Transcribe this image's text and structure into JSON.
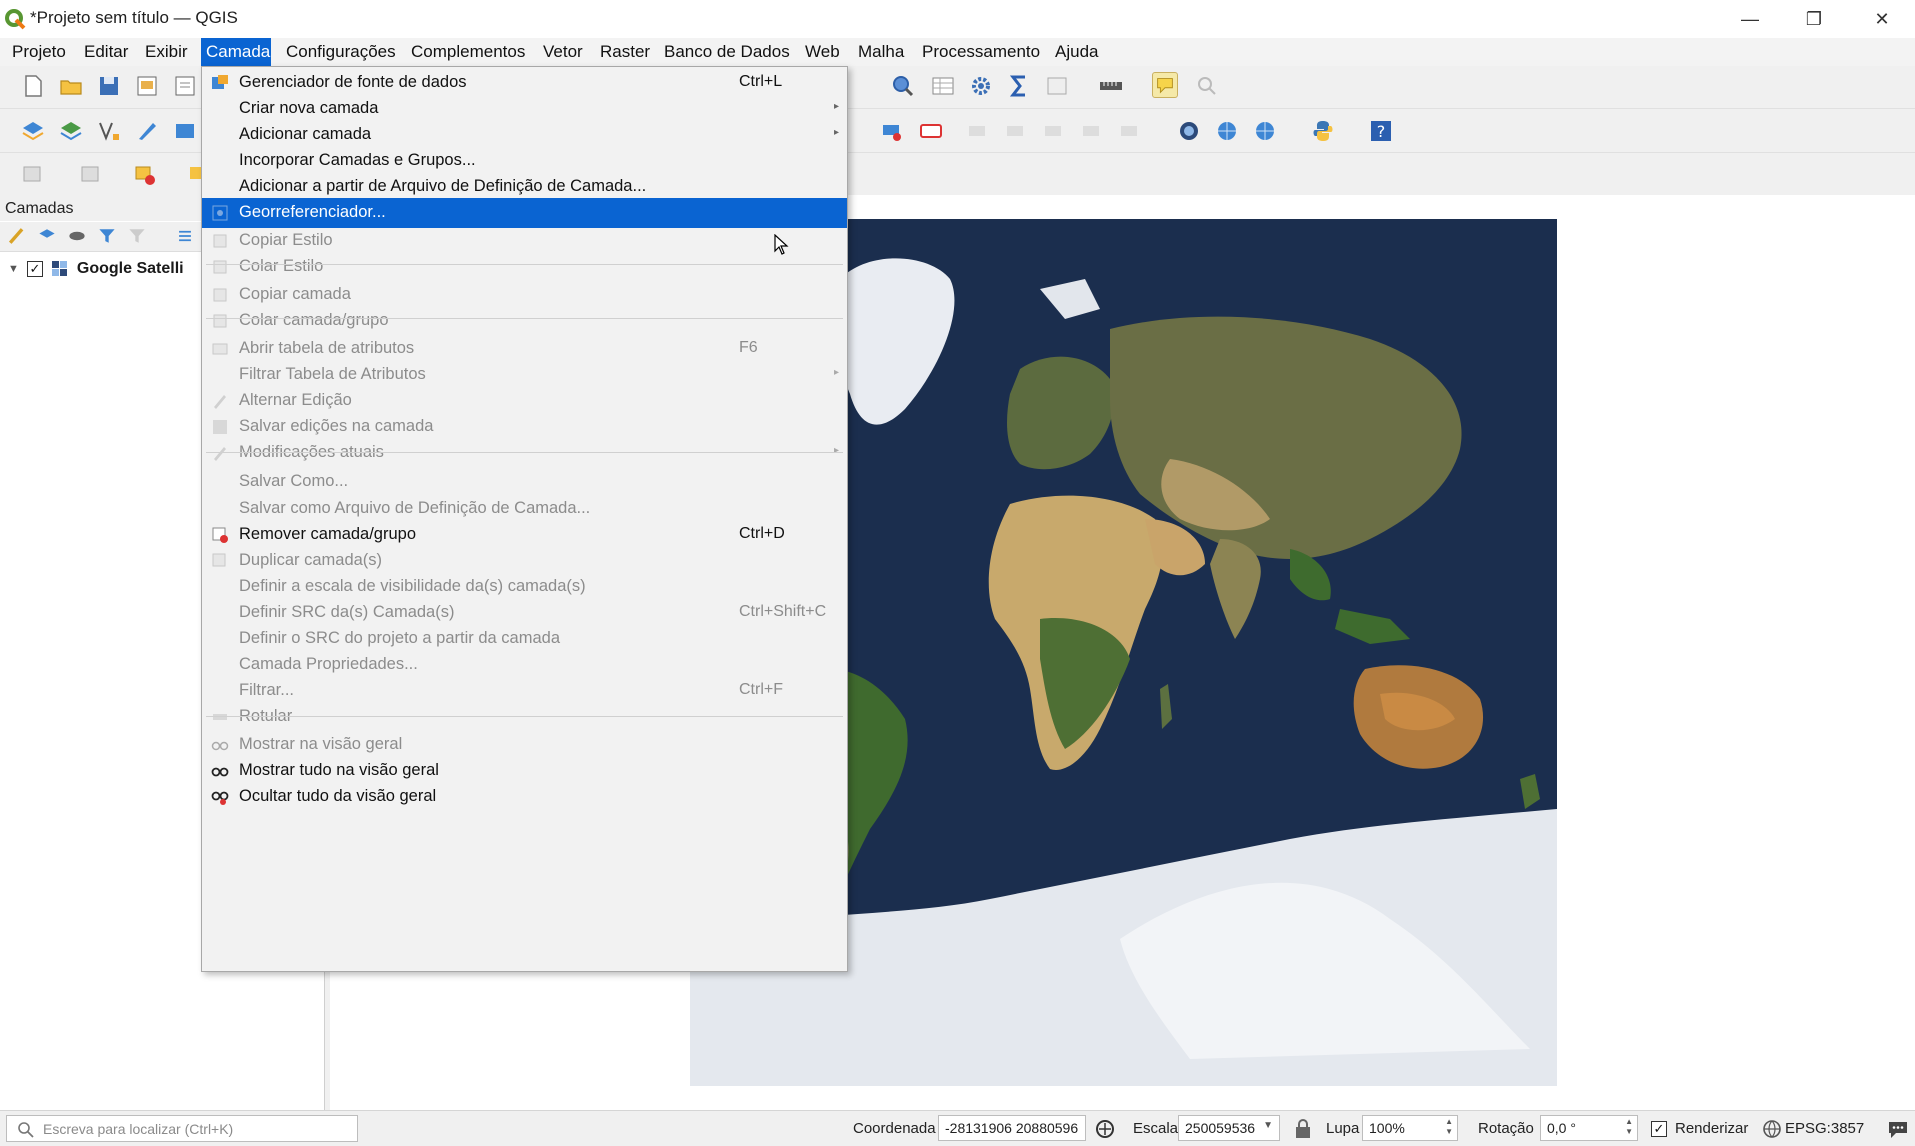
{
  "window": {
    "title": "*Projeto sem título — QGIS",
    "minimize": "—",
    "maximize": "❐",
    "close": "✕"
  },
  "menubar": [
    {
      "label": "Projeto"
    },
    {
      "label": "Editar"
    },
    {
      "label": "Exibir"
    },
    {
      "label": "Camada"
    },
    {
      "label": "Configurações"
    },
    {
      "label": "Complementos"
    },
    {
      "label": "Vetor"
    },
    {
      "label": "Raster"
    },
    {
      "label": "Banco de Dados"
    },
    {
      "label": "Web"
    },
    {
      "label": "Malha"
    },
    {
      "label": "Processamento"
    },
    {
      "label": "Ajuda"
    }
  ],
  "layers_panel": {
    "title": "Camadas",
    "layer": {
      "name": "Google Satelli",
      "checked": "✓",
      "expander": "▼"
    }
  },
  "dropdown": {
    "items": [
      {
        "label": "Gerenciador de fonte de dados",
        "shortcut": "Ctrl+L",
        "icon": "data-source-manager-icon"
      },
      {
        "label": "Criar nova camada",
        "arrow": "▸"
      },
      {
        "label": "Adicionar camada",
        "arrow": "▸"
      },
      {
        "label": "Incorporar Camadas e Grupos..."
      },
      {
        "label": "Adicionar a partir de Arquivo de Definição de Camada..."
      },
      {
        "label": "Georreferenciador...",
        "icon": "georeferencer-icon"
      },
      {
        "label": "Copiar Estilo",
        "icon": "copy-style-icon"
      },
      {
        "label": "Colar Estilo",
        "icon": "paste-style-icon"
      },
      {
        "label": "Copiar camada",
        "icon": "copy-layer-icon"
      },
      {
        "label": "Colar camada/grupo",
        "icon": "paste-layer-icon"
      },
      {
        "label": "Abrir tabela de atributos",
        "shortcut": "F6",
        "icon": "attribute-table-icon"
      },
      {
        "label": "Filtrar Tabela de Atributos",
        "arrow": "▸"
      },
      {
        "label": "Alternar Edição",
        "icon": "pencil-icon"
      },
      {
        "label": "Salvar edições na camada",
        "icon": "save-edits-icon"
      },
      {
        "label": "Modificações atuais",
        "arrow": "▸",
        "icon": "current-edits-icon"
      },
      {
        "label": "Salvar Como..."
      },
      {
        "label": "Salvar como Arquivo de Definição de Camada..."
      },
      {
        "label": "Remover camada/grupo",
        "shortcut": "Ctrl+D",
        "icon": "remove-layer-icon"
      },
      {
        "label": "Duplicar camada(s)",
        "icon": "duplicate-layer-icon"
      },
      {
        "label": "Definir a escala de visibilidade da(s) camada(s)"
      },
      {
        "label": "Definir SRC da(s) Camada(s)",
        "shortcut": "Ctrl+Shift+C"
      },
      {
        "label": "Definir o SRC do projeto a partir da camada"
      },
      {
        "label": "Camada Propriedades..."
      },
      {
        "label": "Filtrar...",
        "shortcut": "Ctrl+F"
      },
      {
        "label": "Rotular",
        "icon": "label-icon"
      },
      {
        "label": "Mostrar na visão geral",
        "icon": "overview-show-icon"
      },
      {
        "label": "Mostrar tudo na visão geral",
        "icon": "overview-show-all-icon"
      },
      {
        "label": "Ocultar tudo da visão geral",
        "icon": "overview-hide-all-icon"
      }
    ]
  },
  "statusbar": {
    "search_placeholder": "Escreva para localizar (Ctrl+K)",
    "coordinate_label": "Coordenada",
    "coordinate_value": "-28131906 20880596",
    "scale_label": "Escala",
    "scale_value": "250059536",
    "magnifier_label": "Lupa",
    "magnifier_value": "100%",
    "rotation_label": "Rotação",
    "rotation_value": "0,0 °",
    "render_label": "Renderizar",
    "render_checked": "✓",
    "crs_label": "EPSG:3857"
  },
  "colors": {
    "accent": "#0a64d2",
    "ocean": "#1b2e4e",
    "ice": "#e9ecf2"
  }
}
